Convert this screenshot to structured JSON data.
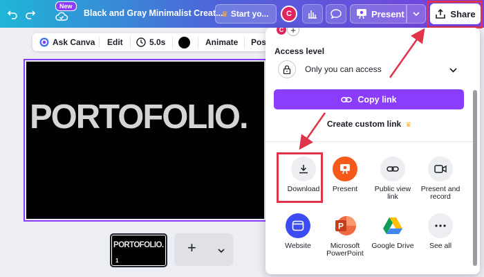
{
  "topbar": {
    "new_badge": "New",
    "doc_title": "Black and Gray Minimalist Creat...",
    "start_label": "Start yo...",
    "avatar_initial": "C",
    "present_label": "Present",
    "share_label": "Share"
  },
  "toolbar": {
    "ask_canva": "Ask Canva",
    "edit": "Edit",
    "duration": "5.0s",
    "animate": "Animate",
    "position": "Posi"
  },
  "canvas": {
    "headline": "PORTOFOLIO."
  },
  "pages": {
    "thumb_text": "PORTOFOLIO.",
    "thumb_number": "1"
  },
  "share_panel": {
    "avatar_initial": "C",
    "add_symbol": "+",
    "access_level_label": "Access level",
    "access_value": "Only you can access",
    "copy_link_label": "Copy link",
    "custom_link_label": "Create custom link",
    "options": [
      {
        "label": "Download",
        "icon": "download-icon"
      },
      {
        "label": "Present",
        "icon": "present-icon"
      },
      {
        "label": "Public view link",
        "icon": "link-icon"
      },
      {
        "label": "Present and record",
        "icon": "camera-icon"
      },
      {
        "label": "Website",
        "icon": "website-icon"
      },
      {
        "label": "Microsoft PowerPoint",
        "icon": "powerpoint-icon"
      },
      {
        "label": "Google Drive",
        "icon": "google-drive-icon"
      },
      {
        "label": "See all",
        "icon": "more-icon"
      }
    ]
  },
  "colors": {
    "accent": "#8b3dff",
    "highlight": "#e0344a",
    "present_orange": "#f55a1a"
  }
}
